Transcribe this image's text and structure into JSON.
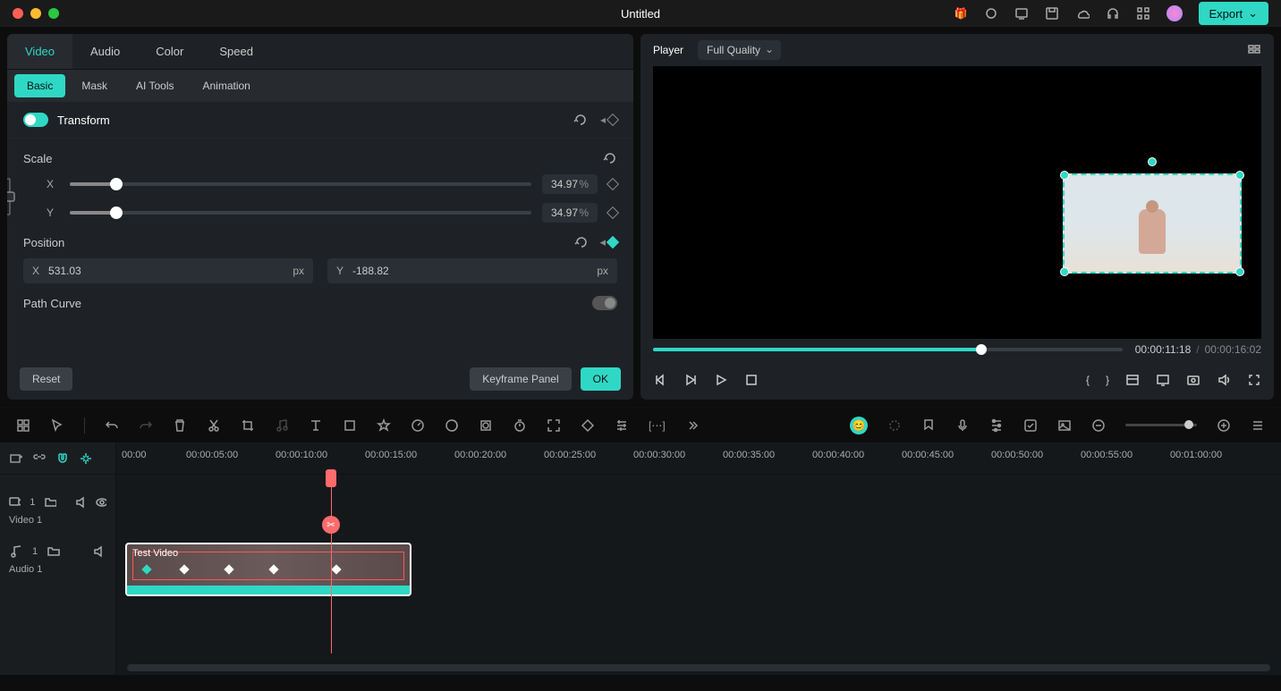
{
  "titlebar": {
    "title": "Untitled",
    "export": "Export"
  },
  "tabs": {
    "video": "Video",
    "audio": "Audio",
    "color": "Color",
    "speed": "Speed"
  },
  "subtabs": {
    "basic": "Basic",
    "mask": "Mask",
    "aitools": "AI Tools",
    "animation": "Animation"
  },
  "transform": {
    "title": "Transform"
  },
  "scale": {
    "label": "Scale",
    "x_label": "X",
    "y_label": "Y",
    "x_value": "34.97",
    "y_value": "34.97",
    "unit": "%"
  },
  "position": {
    "label": "Position",
    "x_label": "X",
    "y_label": "Y",
    "x_value": "531.03",
    "y_value": "-188.82",
    "unit": "px"
  },
  "pathcurve": {
    "label": "Path Curve"
  },
  "buttons": {
    "reset": "Reset",
    "keyframepanel": "Keyframe Panel",
    "ok": "OK"
  },
  "player": {
    "label": "Player",
    "quality": "Full Quality",
    "current": "00:00:11:18",
    "total": "00:00:16:02"
  },
  "timeline": {
    "marks": [
      "00:00",
      "00:00:05:00",
      "00:00:10:00",
      "00:00:15:00",
      "00:00:20:00",
      "00:00:25:00",
      "00:00:30:00",
      "00:00:35:00",
      "00:00:40:00",
      "00:00:45:00",
      "00:00:50:00",
      "00:00:55:00",
      "00:01:00:00"
    ],
    "video_track": "Video 1",
    "audio_track": "Audio 1",
    "video_idx": "1",
    "audio_idx": "1",
    "clip_name": "Test Video"
  }
}
